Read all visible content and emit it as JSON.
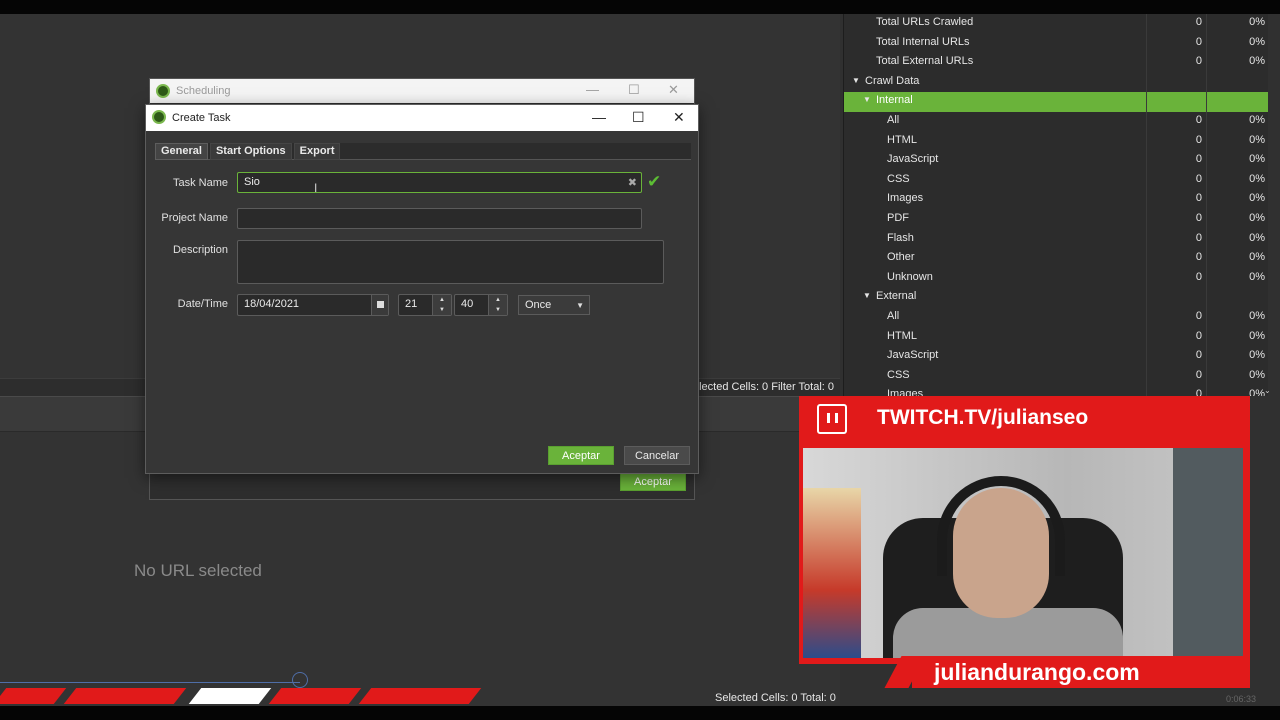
{
  "app": {
    "status_cells_top": "elected Cells: 0  Filter Total: 0",
    "no_url": "No URL selected",
    "status_cells_bottom": "Selected Cells: 0  Total: 0",
    "timecode": "0:06:33"
  },
  "tree": {
    "rows": [
      {
        "label": "Total URLs Crawled",
        "v1": "0",
        "v2": "0%"
      },
      {
        "label": "Total Internal URLs",
        "v1": "0",
        "v2": "0%"
      },
      {
        "label": "Total External URLs",
        "v1": "0",
        "v2": "0%"
      },
      {
        "label": "Crawl Data",
        "v1": "",
        "v2": ""
      },
      {
        "label": "Internal",
        "v1": "",
        "v2": ""
      },
      {
        "label": "All",
        "v1": "0",
        "v2": "0%"
      },
      {
        "label": "HTML",
        "v1": "0",
        "v2": "0%"
      },
      {
        "label": "JavaScript",
        "v1": "0",
        "v2": "0%"
      },
      {
        "label": "CSS",
        "v1": "0",
        "v2": "0%"
      },
      {
        "label": "Images",
        "v1": "0",
        "v2": "0%"
      },
      {
        "label": "PDF",
        "v1": "0",
        "v2": "0%"
      },
      {
        "label": "Flash",
        "v1": "0",
        "v2": "0%"
      },
      {
        "label": "Other",
        "v1": "0",
        "v2": "0%"
      },
      {
        "label": "Unknown",
        "v1": "0",
        "v2": "0%"
      },
      {
        "label": "External",
        "v1": "",
        "v2": ""
      },
      {
        "label": "All",
        "v1": "0",
        "v2": "0%"
      },
      {
        "label": "HTML",
        "v1": "0",
        "v2": "0%"
      },
      {
        "label": "JavaScript",
        "v1": "0",
        "v2": "0%"
      },
      {
        "label": "CSS",
        "v1": "0",
        "v2": "0%"
      },
      {
        "label": "Images",
        "v1": "0",
        "v2": "0%"
      }
    ]
  },
  "scheduling": {
    "title": "Scheduling",
    "ok_label": "Aceptar",
    "minimize": "—",
    "maximize": "☐",
    "close": "✕"
  },
  "create_task": {
    "title": "Create Task",
    "minimize": "—",
    "maximize": "☐",
    "close": "✕",
    "tabs": [
      "General",
      "Start Options",
      "Export"
    ],
    "task_name_label": "Task Name",
    "task_name_value": "Sio",
    "project_name_label": "Project Name",
    "project_name_value": "",
    "description_label": "Description",
    "description_value": "",
    "datetime_label": "Date/Time",
    "date_value": "18/04/2021",
    "hour_value": "21",
    "minute_value": "40",
    "repeat_value": "Once",
    "ok_label": "Aceptar",
    "cancel_label": "Cancelar"
  },
  "overlay": {
    "header_text": "TWITCH.TV/julianseo",
    "footer_text": "juliandurango.com"
  },
  "colors": {
    "accent_green": "#6ab33a",
    "twitch_red": "#e11a1a"
  },
  "icons": {
    "check": "✔",
    "clear": "✖",
    "calendar": "calendar-icon",
    "twitch": "twitch-icon",
    "text_cursor": "I"
  }
}
